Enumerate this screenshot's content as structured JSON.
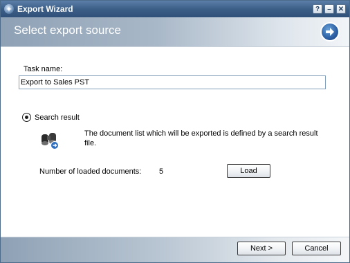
{
  "window": {
    "title": "Export Wizard",
    "help_glyph": "?",
    "minimize_glyph": "–",
    "close_glyph": "✕",
    "title_icon": "wizard-app-icon"
  },
  "header": {
    "title": "Select export source",
    "icon": "next-arrow-icon"
  },
  "task": {
    "label": "Task name:",
    "value": "Export to Sales PST"
  },
  "source": {
    "option_label": "Search result",
    "selected": true,
    "icon": "binoculars-icon",
    "description": "The document list which will be exported is defined by a search result file.",
    "loaded_label": "Number of loaded documents:",
    "loaded_count": "5",
    "load_button": "Load"
  },
  "footer": {
    "next_button": "Next >",
    "cancel_button": "Cancel"
  }
}
